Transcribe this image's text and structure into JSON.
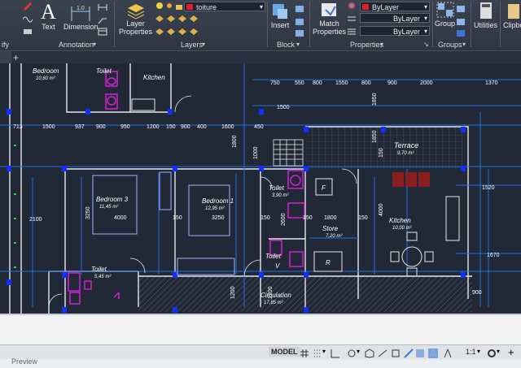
{
  "ribbon": {
    "clipped_left_label": "ify",
    "text_btn": "Text",
    "dimension_btn": "Dimension",
    "annotation_panel": "Annotation",
    "layer_properties_btn": [
      "Layer",
      "Properties"
    ],
    "layer_combo_value": "toiture",
    "layers_panel": "Layers",
    "insert_btn": "Insert",
    "block_panel": "Block",
    "match_properties_btn": [
      "Match",
      "Properties"
    ],
    "color_combo": "ByLayer",
    "linetype_combo": "ByLayer",
    "lineweight_combo": "ByLayer",
    "properties_panel": "Properties",
    "group_btn": "Group",
    "groups_panel": "Groups",
    "utilities_btn": "Utilities",
    "clipboard_btn": "Clipbo",
    "brand_color": "#e8e8e8"
  },
  "tabs": {
    "add_tab": "+"
  },
  "drawing": {
    "rooms": [
      {
        "name": "Bedroom",
        "area": "10,60 m²"
      },
      {
        "name": "Toilet",
        "area": ""
      },
      {
        "name": "Kitchen",
        "area": ""
      },
      {
        "name": "Terrace",
        "area": "9,70 m²"
      },
      {
        "name": "Bedroom 3",
        "area": "11,45 m²"
      },
      {
        "name": "Bedroom 1",
        "area": "12,95 m²"
      },
      {
        "name": "Toilet",
        "area": "3,90 m²"
      },
      {
        "name": "Store",
        "area": "7,20 m²"
      },
      {
        "name": "Kitchen",
        "area": "10,00 m²"
      },
      {
        "name": "Toilet",
        "area": "5,45 m²"
      },
      {
        "name": "Toilet",
        "area": ""
      },
      {
        "name": "Circulation",
        "area": "17,85 m²"
      }
    ],
    "dims_top_right": [
      "750",
      "550",
      "800",
      "1550",
      "800",
      "900",
      "2000",
      "1370"
    ],
    "dims_row2": [
      "713",
      "1500",
      "937",
      "900",
      "950",
      "1200",
      "150",
      "900",
      "400",
      "1600",
      "450"
    ],
    "dims_misc": [
      "1500",
      "1850",
      "1800",
      "1000",
      "150",
      "1520",
      "2100",
      "3250",
      "4000",
      "150",
      "3250",
      "150",
      "2600",
      "150",
      "1800",
      "150",
      "4000",
      "1670",
      "1200",
      "1200",
      "900",
      "1850"
    ],
    "door_labels": [
      "F",
      "R",
      "V"
    ],
    "colors": {
      "dim_text": "#ffffff",
      "dim_line": "#1f6fe0",
      "room_text": "#ffffff",
      "fixture": "#e020e0",
      "fill_red": "#8a1f1f",
      "column": "#1030ff"
    }
  },
  "status": {
    "model_tab": "MODEL",
    "scale": "1:1",
    "bottom_text": "Preview"
  }
}
